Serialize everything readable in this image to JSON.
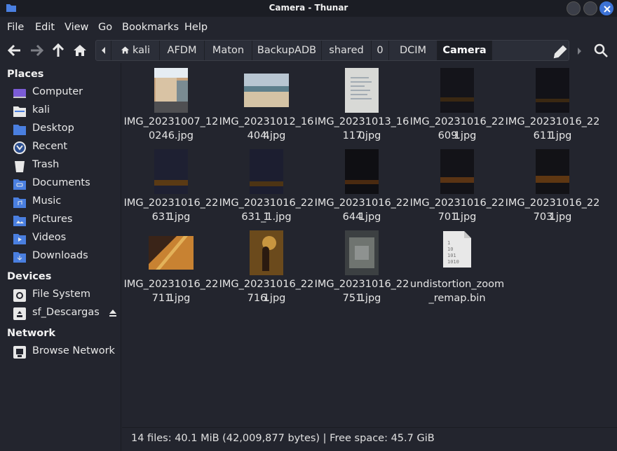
{
  "window": {
    "title": "Camera - Thunar"
  },
  "menu": [
    "File",
    "Edit",
    "View",
    "Go",
    "Bookmarks",
    "Help"
  ],
  "breadcrumbs": [
    "kali",
    "AFDM",
    "Maton",
    "BackupADB",
    "shared",
    "0",
    "DCIM",
    "Camera"
  ],
  "sidebar": {
    "places_title": "Places",
    "places": [
      "Computer",
      "kali",
      "Desktop",
      "Recent",
      "Trash",
      "Documents",
      "Music",
      "Pictures",
      "Videos",
      "Downloads"
    ],
    "devices_title": "Devices",
    "devices": [
      "File System",
      "sf_Descargas"
    ],
    "network_title": "Network",
    "network": [
      "Browse Network"
    ]
  },
  "files": [
    {
      "line1": "IMG_20231007_12",
      "line2": "0246.jpg"
    },
    {
      "line1": "IMG_20231012_164",
      "line2": "404.jpg"
    },
    {
      "line1": "IMG_20231013_160",
      "line2": "117.jpg"
    },
    {
      "line1": "IMG_20231016_221",
      "line2": "609.jpg"
    },
    {
      "line1": "IMG_20231016_221",
      "line2": "611.jpg"
    },
    {
      "line1": "IMG_20231016_221",
      "line2": "631.jpg"
    },
    {
      "line1": "IMG_20231016_221",
      "line2": "631_1.jpg"
    },
    {
      "line1": "IMG_20231016_221",
      "line2": "644.jpg"
    },
    {
      "line1": "IMG_20231016_221",
      "line2": "701.jpg"
    },
    {
      "line1": "IMG_20231016_221",
      "line2": "703.jpg"
    },
    {
      "line1": "IMG_20231016_221",
      "line2": "711.jpg"
    },
    {
      "line1": "IMG_20231016_221",
      "line2": "716.jpg"
    },
    {
      "line1": "IMG_20231016_221",
      "line2": "751.jpg"
    },
    {
      "line1": "undistortion_zoom",
      "line2": "_remap.bin"
    }
  ],
  "status": "14 files: 40.1 MiB (42,009,877 bytes)  |  Free space: 45.7 GiB",
  "colors": {
    "accent": "#3d73d6",
    "folder": "#4a7fe0",
    "background": "#23252e"
  }
}
